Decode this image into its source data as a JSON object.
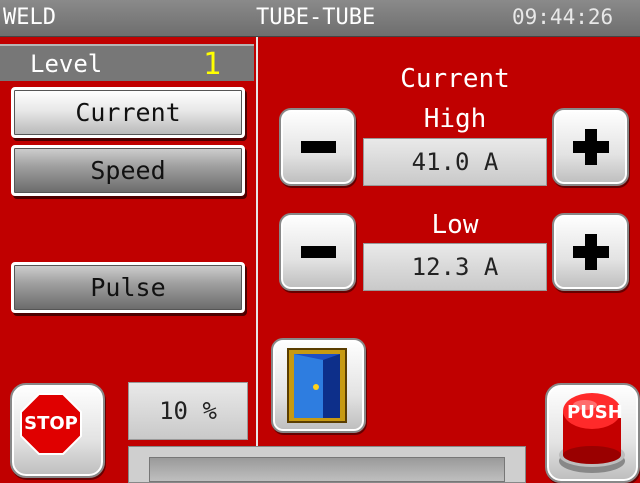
{
  "title_bar": {
    "left": "WELD",
    "center": "TUBE-TUBE",
    "clock": "09:44:26"
  },
  "level": {
    "label": "Level",
    "value": "1"
  },
  "mode_buttons": {
    "current": "Current",
    "speed": "Speed",
    "pulse": "Pulse"
  },
  "current_panel": {
    "heading": "Current",
    "high_label": "High",
    "high_value": "41.0 A",
    "low_label": "Low",
    "low_value": "12.3 A"
  },
  "percent": {
    "value": "10 %"
  },
  "buttons": {
    "stop_label": "STOP",
    "push_label": "PUSH"
  },
  "icons": {
    "minus": "minus-icon",
    "plus": "plus-icon",
    "door": "door-exit-icon",
    "stop": "stop-sign-icon",
    "push": "push-button-icon"
  },
  "colors": {
    "background": "#c00000",
    "level_value": "#ffff00"
  }
}
